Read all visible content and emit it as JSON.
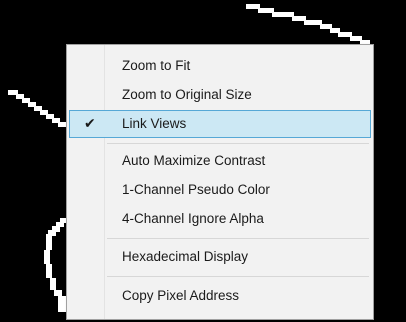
{
  "menu": {
    "groups": [
      {
        "items": [
          {
            "label": "Zoom to Fit"
          },
          {
            "label": "Zoom to Original Size"
          },
          {
            "label": "Link Views",
            "checked": true,
            "highlighted": true
          }
        ]
      },
      {
        "items": [
          {
            "label": "Auto Maximize Contrast"
          },
          {
            "label": "1-Channel Pseudo Color"
          },
          {
            "label": "4-Channel Ignore Alpha"
          }
        ]
      },
      {
        "items": [
          {
            "label": "Hexadecimal Display"
          }
        ]
      },
      {
        "items": [
          {
            "label": "Copy Pixel Address"
          }
        ]
      }
    ]
  },
  "icons": {
    "check": "✔"
  },
  "colors": {
    "highlight_bg": "#cce8f4",
    "highlight_border": "#56a8d6",
    "menu_bg": "#f2f2f2",
    "canvas_bg": "#000000"
  }
}
